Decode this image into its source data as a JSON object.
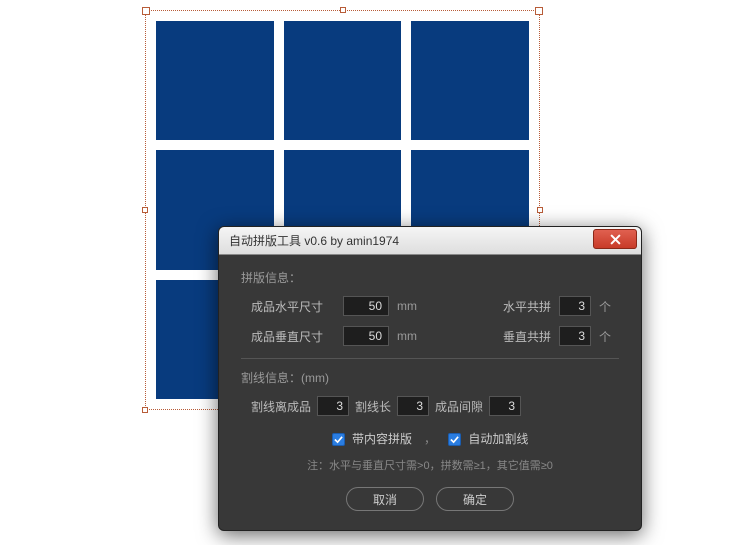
{
  "dialog": {
    "title": "自动拼版工具 v0.6   by amin1974",
    "layout_section_title": "拼版信息：",
    "horizontal_size_label": "成品水平尺寸",
    "horizontal_size_value": "50",
    "vertical_size_label": "成品垂直尺寸",
    "vertical_size_value": "50",
    "size_unit": "mm",
    "horizontal_count_label": "水平共拼",
    "horizontal_count_value": "3",
    "vertical_count_label": "垂直共拼",
    "vertical_count_value": "3",
    "count_unit": "个",
    "cut_section_title": "割线信息：(mm)",
    "cut_margin_label": "割线离成品",
    "cut_margin_value": "3",
    "cut_length_label": "割线长",
    "cut_length_value": "3",
    "gap_label": "成品间隙",
    "gap_value": "3",
    "with_content_label": "带内容拼版",
    "auto_cut_label": "自动加割线",
    "separator": "，",
    "note": "注：水平与垂直尺寸需>0，拼数需≥1，其它值需≥0",
    "cancel_label": "取消",
    "ok_label": "确定"
  },
  "canvas": {
    "grid_rows": 3,
    "grid_cols": 3,
    "fill_color": "#083b7e"
  }
}
